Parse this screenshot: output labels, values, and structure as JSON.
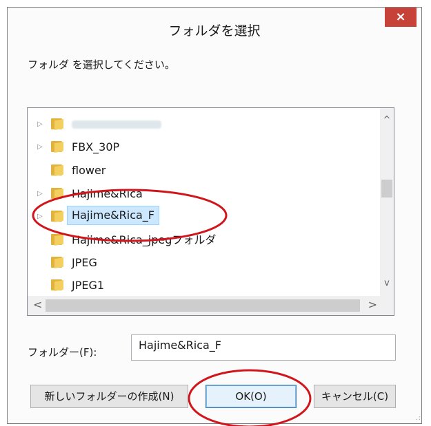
{
  "window": {
    "title": "フォルダを選択",
    "close_glyph": "×"
  },
  "prompt": "フォルダ を選択してください。",
  "tree": {
    "items": [
      {
        "label": "",
        "blurred": true,
        "has_children": true
      },
      {
        "label": "FBX_30P",
        "has_children": true
      },
      {
        "label": "flower",
        "has_children": false
      },
      {
        "label": "Hajime&Rica",
        "has_children": true
      },
      {
        "label": "Hajime&Rica_F",
        "has_children": true,
        "selected": true
      },
      {
        "label": "Hajime&Rica_jpegフォルダ",
        "has_children": false
      },
      {
        "label": "JPEG",
        "has_children": false
      },
      {
        "label": "JPEG1",
        "has_children": false
      }
    ]
  },
  "scroll": {
    "up": "^",
    "down": "v",
    "left": "<",
    "right": ">"
  },
  "folder_field": {
    "label": "フォルダー(F):",
    "value": "Hajime&Rica_F"
  },
  "buttons": {
    "new_folder": "新しいフォルダーの作成(N)",
    "ok": "OK(O)",
    "cancel": "キャンセル(C)"
  },
  "colors": {
    "close": "#c7433a",
    "annotation": "#d0161c",
    "selection": "#cce8ff",
    "folder": "#f3cf5f"
  },
  "icons": {
    "folder": "folder-icon",
    "expander": "triangle-right-icon",
    "grip": "resize-grip-icon"
  }
}
